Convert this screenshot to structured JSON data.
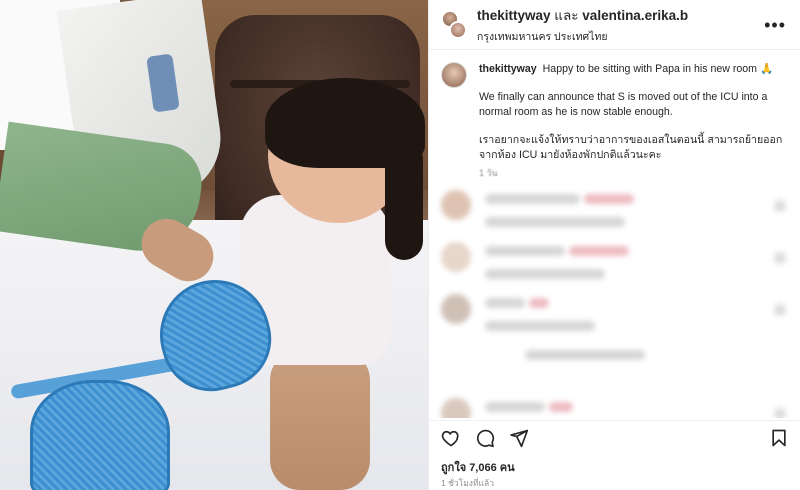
{
  "header": {
    "user1": "thekittyway",
    "conjunction": "และ",
    "user2": "valentina.erika.b",
    "location": "กรุงเทพมหานคร ประเทศไทย",
    "more_icon": "more-dots-icon"
  },
  "caption": {
    "username": "thekittyway",
    "line1": "Happy to be sitting with Papa in his new room 🙏",
    "line2": "We finally can announce that S is moved out of the ICU into a normal room as he is now stable enough.",
    "line3": "เราอยากจะแจ้งให้ทราบว่าอาการของเอสในตอนนี้ สามารถย้ายออกจากห้อง ICU มายังห้องพักปกติแล้วนะคะ",
    "time": "1 วัน"
  },
  "blurred_comment_avatar_colors": [
    "#d9b9a6",
    "#e3cfc1",
    "#c7b6aa",
    "#dcdcdc",
    "#d2bfb2"
  ],
  "actions": {
    "like_icon": "heart-icon",
    "comment_icon": "comment-icon",
    "share_icon": "send-icon",
    "save_icon": "bookmark-icon"
  },
  "stats": {
    "likes": "ถูกใจ 7,066 คน",
    "time_ago": "1 ชั่วโมงที่แล้ว"
  }
}
